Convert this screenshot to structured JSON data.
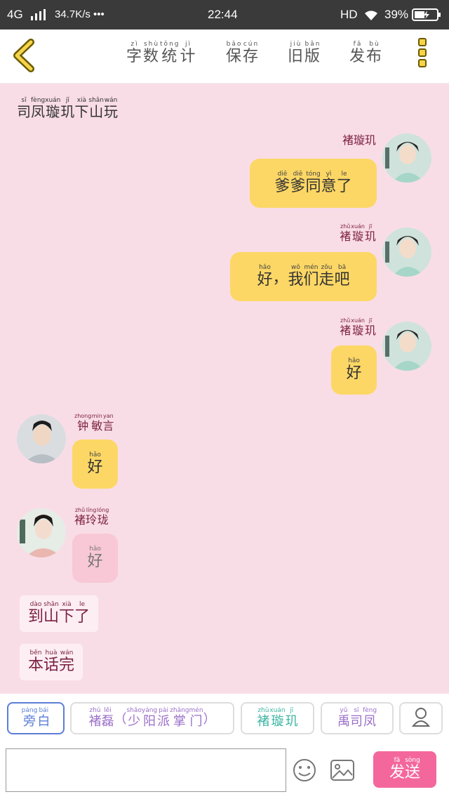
{
  "status": {
    "network": "4G",
    "speed": "34.7K/s •••",
    "time": "22:44",
    "hd": "HD",
    "battery": "39%"
  },
  "toolbar": {
    "items": [
      {
        "chars": [
          "字",
          "数",
          "统",
          "计"
        ],
        "pinyin": [
          "zì",
          "shù",
          "tǒng",
          "jì"
        ]
      },
      {
        "chars": [
          "保",
          "存"
        ],
        "pinyin": [
          "bǎo",
          "cún"
        ]
      },
      {
        "chars": [
          "旧",
          "版"
        ],
        "pinyin": [
          "jiù",
          "bǎn"
        ]
      },
      {
        "chars": [
          "发",
          "布"
        ],
        "pinyin": [
          "fā",
          "bù"
        ]
      }
    ]
  },
  "scene_title": {
    "chars": [
      "司",
      "凤",
      "璇",
      "玑",
      "下",
      "山",
      "玩"
    ],
    "pinyin": [
      "sī",
      "fèng",
      "xuán",
      "jī",
      "xià",
      "shān",
      "wán"
    ]
  },
  "messages": [
    {
      "name": {
        "chars": [
          "褚",
          "璇",
          "玑"
        ],
        "pinyin": [
          "",
          "",
          ""
        ]
      },
      "text": {
        "chars": [
          "爹",
          "爹",
          "同",
          "意",
          "了"
        ],
        "pinyin": [
          "diē",
          "diē",
          "tóng",
          "yì",
          "le"
        ]
      }
    },
    {
      "name": {
        "chars": [
          "褚",
          "璇",
          "玑"
        ],
        "pinyin": [
          "zhǔ",
          "xuán",
          "jī"
        ]
      },
      "text": {
        "chars": [
          "好",
          "，",
          "我",
          "们",
          "走",
          "吧"
        ],
        "pinyin": [
          "hǎo",
          "",
          "wǒ",
          "mén",
          "zǒu",
          "bā"
        ]
      }
    },
    {
      "name": {
        "chars": [
          "褚",
          "璇",
          "玑"
        ],
        "pinyin": [
          "zhǔ",
          "xuán",
          "jī"
        ]
      },
      "text": {
        "chars": [
          "好"
        ],
        "pinyin": [
          "hǎo"
        ]
      }
    },
    {
      "name": {
        "chars": [
          "钟",
          "敏",
          "言"
        ],
        "pinyin": [
          "zhong",
          "min",
          "yan"
        ]
      },
      "text": {
        "chars": [
          "好"
        ],
        "pinyin": [
          "hǎo"
        ]
      }
    },
    {
      "name": {
        "chars": [
          "褚",
          "玲",
          "珑"
        ],
        "pinyin": [
          "zhǔ",
          "líng",
          "lóng"
        ]
      },
      "text": {
        "chars": [
          "好"
        ],
        "pinyin": [
          "hǎo"
        ]
      }
    }
  ],
  "narrations": [
    {
      "chars": [
        "到",
        "山",
        "下",
        "了"
      ],
      "pinyin": [
        "dào",
        "shān",
        "xià",
        "le"
      ]
    },
    {
      "chars": [
        "本",
        "话",
        "完"
      ],
      "pinyin": [
        "běn",
        "huà",
        "wán"
      ]
    }
  ],
  "roles": [
    {
      "chars": [
        "旁",
        "白"
      ],
      "pinyin": [
        "páng",
        "bái"
      ],
      "color": "#5b7ed6"
    },
    {
      "chars": [
        "褚",
        "磊",
        "（",
        "少",
        "阳",
        "派",
        "掌",
        "门",
        "）"
      ],
      "pinyin": [
        "zhǔ",
        "lěi",
        "",
        "shǎo",
        "yáng",
        "pài",
        "zhǎng",
        "mén",
        ""
      ],
      "color": "#9b6fc8"
    },
    {
      "chars": [
        "褚",
        "璇",
        "玑"
      ],
      "pinyin": [
        "zhǔ",
        "xuán",
        "jī"
      ],
      "color": "#3bb4a2"
    },
    {
      "chars": [
        "禹",
        "司",
        "凤"
      ],
      "pinyin": [
        "yǔ",
        "sī",
        "fèng"
      ],
      "color": "#9b6fc8"
    }
  ],
  "send": {
    "chars": [
      "发",
      "送"
    ],
    "pinyin": [
      "fā",
      "sòng"
    ]
  },
  "colors": {
    "accent": "#f4679c",
    "bubble": "#fcd765",
    "background": "#f9dde6"
  }
}
